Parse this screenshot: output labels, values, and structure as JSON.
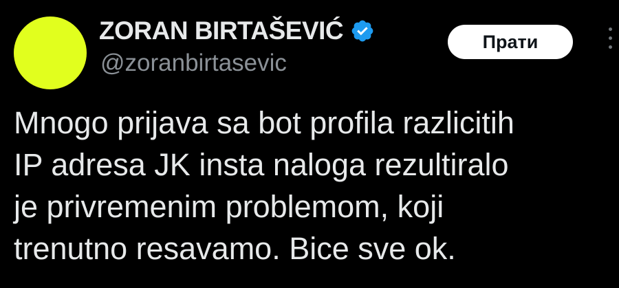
{
  "author": {
    "display_name": "ZORAN BIRTAŠEVIĆ",
    "handle": "@zoranbirtasevic",
    "verified_icon": "verified-badge",
    "avatar_color": "#e1ff1e",
    "verified_color": "#1d9bf0"
  },
  "actions": {
    "follow_label": "Прати",
    "more_icon": "more-vertical-icon"
  },
  "tweet": {
    "lines": [
      "Mnogo prijava sa bot profila razlicitih",
      "IP adresa JK insta naloga rezultiralo",
      "je privremenim problemom, koji",
      "trenutno resavamo. Bice sve ok."
    ]
  }
}
